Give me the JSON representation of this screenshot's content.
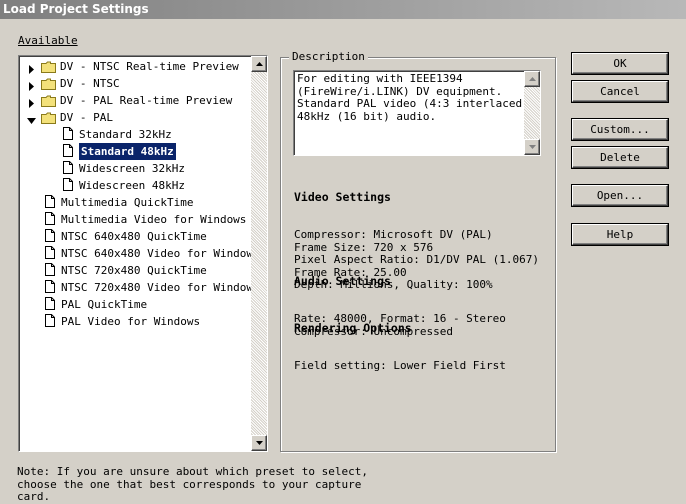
{
  "window": {
    "title": "Load Project Settings"
  },
  "available": {
    "label": "Available"
  },
  "presets": [
    {
      "label": "DV - NTSC Real-time Preview",
      "type": "folder",
      "level": 0,
      "expanded": false
    },
    {
      "label": "DV - NTSC",
      "type": "folder",
      "level": 0,
      "expanded": false
    },
    {
      "label": "DV - PAL Real-time Preview",
      "type": "folder",
      "level": 0,
      "expanded": false
    },
    {
      "label": "DV - PAL",
      "type": "folder",
      "level": 0,
      "expanded": true
    },
    {
      "label": "Standard 32kHz",
      "type": "file",
      "level": 1
    },
    {
      "label": "Standard 48kHz",
      "type": "file",
      "level": 1,
      "selected": true
    },
    {
      "label": "Widescreen 32kHz",
      "type": "file",
      "level": 1
    },
    {
      "label": "Widescreen 48kHz",
      "type": "file",
      "level": 1
    },
    {
      "label": "Multimedia QuickTime",
      "type": "file",
      "level": 0
    },
    {
      "label": "Multimedia Video for Windows",
      "type": "file",
      "level": 0
    },
    {
      "label": "NTSC 640x480 QuickTime",
      "type": "file",
      "level": 0
    },
    {
      "label": "NTSC 640x480 Video for Windows",
      "type": "file",
      "level": 0
    },
    {
      "label": "NTSC 720x480 QuickTime",
      "type": "file",
      "level": 0
    },
    {
      "label": "NTSC 720x480 Video for Windows",
      "type": "file",
      "level": 0
    },
    {
      "label": "PAL QuickTime",
      "type": "file",
      "level": 0
    },
    {
      "label": "PAL Video for Windows",
      "type": "file",
      "level": 0
    }
  ],
  "description": {
    "group_label": "Description",
    "text": "For editing with IEEE1394\n(FireWire/i.LINK) DV equipment.\nStandard PAL video (4:3 interlaced).\n48kHz (16 bit) audio."
  },
  "video_settings": {
    "heading": "Video Settings",
    "lines": "Compressor: Microsoft DV (PAL)\nFrame Size: 720 x 576\nPixel Aspect Ratio: D1/DV PAL (1.067)\nFrame Rate: 25.00\nDepth: Millions, Quality: 100%"
  },
  "audio_settings": {
    "heading": "Audio Settings",
    "lines": "Rate: 48000, Format: 16 - Stereo\nCompressor: Uncompressed"
  },
  "rendering_options": {
    "heading": "Rendering Options",
    "lines": "Field setting: Lower Field First"
  },
  "buttons": {
    "ok": "OK",
    "cancel": "Cancel",
    "custom": "Custom...",
    "delete": "Delete",
    "open": "Open...",
    "help": "Help"
  },
  "note": "Note: If you are unsure about which preset to select,\nchoose the one that best corresponds to your capture\ncard."
}
